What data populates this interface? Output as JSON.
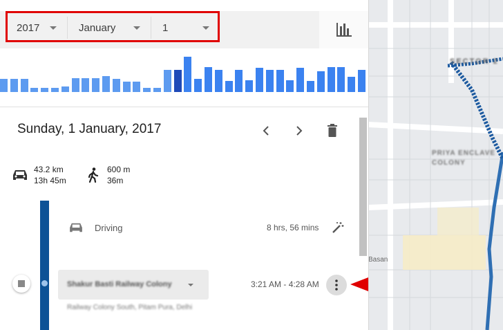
{
  "selectors": {
    "year": "2017",
    "month": "January",
    "day": "1"
  },
  "day_bars": [
    {
      "level": 0.33,
      "tone": "light"
    },
    {
      "level": 0.33,
      "tone": "light"
    },
    {
      "level": 0.33,
      "tone": "light"
    },
    {
      "level": 0.1,
      "tone": "light"
    },
    {
      "level": 0.1,
      "tone": "light"
    },
    {
      "level": 0.1,
      "tone": "light"
    },
    {
      "level": 0.13,
      "tone": "light"
    },
    {
      "level": 0.35,
      "tone": "light"
    },
    {
      "level": 0.35,
      "tone": "light"
    },
    {
      "level": 0.35,
      "tone": "light"
    },
    {
      "level": 0.4,
      "tone": "light"
    },
    {
      "level": 0.33,
      "tone": "light"
    },
    {
      "level": 0.25,
      "tone": "light"
    },
    {
      "level": 0.25,
      "tone": "light"
    },
    {
      "level": 0.1,
      "tone": "light"
    },
    {
      "level": 0.1,
      "tone": "light"
    },
    {
      "level": 0.55,
      "tone": "light"
    },
    {
      "level": 0.55,
      "tone": "selected"
    },
    {
      "level": 0.88,
      "tone": "medium"
    },
    {
      "level": 0.33,
      "tone": "medium"
    },
    {
      "level": 0.62,
      "tone": "medium"
    },
    {
      "level": 0.55,
      "tone": "medium"
    },
    {
      "level": 0.28,
      "tone": "medium"
    },
    {
      "level": 0.55,
      "tone": "medium"
    },
    {
      "level": 0.3,
      "tone": "medium"
    },
    {
      "level": 0.6,
      "tone": "medium"
    },
    {
      "level": 0.55,
      "tone": "medium"
    },
    {
      "level": 0.55,
      "tone": "medium"
    },
    {
      "level": 0.3,
      "tone": "medium"
    },
    {
      "level": 0.6,
      "tone": "medium"
    },
    {
      "level": 0.28,
      "tone": "medium"
    },
    {
      "level": 0.52,
      "tone": "medium"
    },
    {
      "level": 0.62,
      "tone": "medium"
    },
    {
      "level": 0.62,
      "tone": "medium"
    },
    {
      "level": 0.38,
      "tone": "medium"
    },
    {
      "level": 0.55,
      "tone": "medium"
    }
  ],
  "bar_colors": {
    "light": "#5d9bf0",
    "medium": "#3b82f0",
    "selected": "#1f4ab8"
  },
  "day": {
    "title": "Sunday, 1 January, 2017"
  },
  "stats": {
    "driving": {
      "distance": "43.2 km",
      "duration": "13h 45m",
      "icon": "car-icon"
    },
    "walking": {
      "distance": "600 m",
      "duration": "36m",
      "icon": "walking-icon"
    }
  },
  "segment": {
    "label": "Driving",
    "duration": "8 hrs, 56 mins",
    "icon": "car-icon",
    "edit_icon": "magic-wand-icon"
  },
  "place": {
    "name": "Shakur Basti Railway Colony",
    "address": "Railway Colony South, Pitam Pura, Delhi",
    "time": "3:21 AM - 4:28 AM"
  },
  "map": {
    "labels": [
      "SECTOR 2",
      "PRIYA ENCLAVE COLONY",
      "Basan"
    ]
  },
  "accent_colors": {
    "route": "#0d5296",
    "highlight": "#e00000"
  }
}
